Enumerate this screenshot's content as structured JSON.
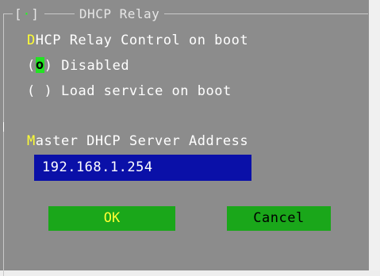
{
  "dialog": {
    "title": "DHCP Relay",
    "close_glyph": "[",
    "close_dot": "·",
    "close_end": "]"
  },
  "relay": {
    "heading_hot": "D",
    "heading_rest": "HCP Relay Control on boot",
    "options": [
      {
        "open": "(",
        "mark": "o",
        "close": ")",
        "label": " Disabled",
        "selected": true
      },
      {
        "open": "(",
        "mark": " ",
        "close": ")",
        "label": " Load service on boot",
        "selected": false
      }
    ]
  },
  "server": {
    "heading_hot": "M",
    "heading_rest": "aster DHCP Server Address",
    "address": "192.168.1.254"
  },
  "buttons": {
    "ok": "OK",
    "cancel": "Cancel"
  },
  "colors": {
    "background": "#8c8c8c",
    "hotkey": "#ffff33",
    "field": "#0a10a8",
    "button": "#1aa71a"
  }
}
